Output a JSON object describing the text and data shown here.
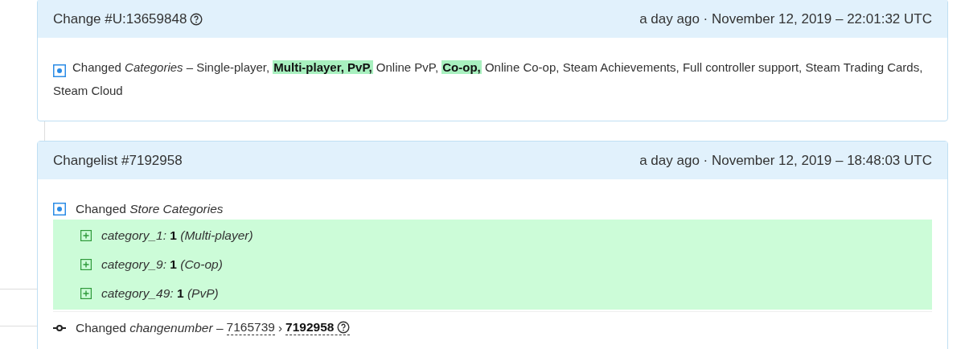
{
  "changes": [
    {
      "title": "Change #U:13659848",
      "help": true,
      "time": "a day ago · November 12, 2019 – 22:01:32 UTC",
      "kind": "inline",
      "segments": [
        {
          "text": "Changed *Categories* – Single-player,",
          "added": false
        },
        {
          "text": "Multi-player, PvP,",
          "added": true
        },
        {
          "text": "Online PvP,",
          "added": false
        },
        {
          "text": "Co-op,",
          "added": true
        },
        {
          "text": "Online Co-op, Steam Achievements, Full controller support, Steam Trading Cards, Steam Cloud",
          "added": false
        }
      ]
    },
    {
      "title": "Changelist #7192958",
      "help": false,
      "time": "a day ago · November 12, 2019 – 18:48:03 UTC",
      "kind": "list",
      "heading": "Changed *Store Categories*",
      "items": [
        {
          "key": "category_1:",
          "value": "1",
          "note": "(Multi-player)"
        },
        {
          "key": "category_9:",
          "value": "1",
          "note": "(Co-op)"
        },
        {
          "key": "category_49:",
          "value": "1",
          "note": "(PvP)"
        }
      ],
      "number": {
        "label": "Changed *changenumber* –",
        "old": "7165739",
        "sep": "›",
        "new": "7192958"
      }
    }
  ]
}
